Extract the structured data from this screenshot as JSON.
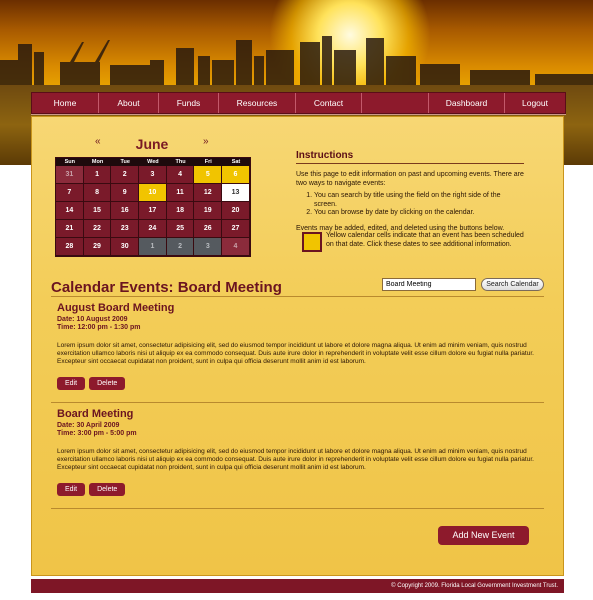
{
  "nav": {
    "items": [
      {
        "label": "Home"
      },
      {
        "label": "About"
      },
      {
        "label": "Funds"
      },
      {
        "label": "Resources"
      },
      {
        "label": "Contact"
      },
      {
        "label": ""
      },
      {
        "label": "Dashboard"
      },
      {
        "label": "Logout"
      }
    ]
  },
  "calendar": {
    "prev": "«",
    "next": "»",
    "month": "June",
    "weekdays": [
      "Sun",
      "Mon",
      "Tue",
      "Wed",
      "Thu",
      "Fri",
      "Sat"
    ],
    "weeks": [
      [
        {
          "d": "31",
          "s": "other"
        },
        {
          "d": "1"
        },
        {
          "d": "2"
        },
        {
          "d": "3"
        },
        {
          "d": "4"
        },
        {
          "d": "5",
          "s": "ev"
        },
        {
          "d": "6",
          "s": "ev"
        }
      ],
      [
        {
          "d": "7"
        },
        {
          "d": "8"
        },
        {
          "d": "9"
        },
        {
          "d": "10",
          "s": "ev"
        },
        {
          "d": "11"
        },
        {
          "d": "12"
        },
        {
          "d": "13",
          "s": "today"
        }
      ],
      [
        {
          "d": "14"
        },
        {
          "d": "15"
        },
        {
          "d": "16"
        },
        {
          "d": "17"
        },
        {
          "d": "18"
        },
        {
          "d": "19"
        },
        {
          "d": "20"
        }
      ],
      [
        {
          "d": "21"
        },
        {
          "d": "22"
        },
        {
          "d": "23"
        },
        {
          "d": "24"
        },
        {
          "d": "25"
        },
        {
          "d": "26"
        },
        {
          "d": "27"
        }
      ],
      [
        {
          "d": "28"
        },
        {
          "d": "29"
        },
        {
          "d": "30"
        },
        {
          "d": "1",
          "s": "other2"
        },
        {
          "d": "2",
          "s": "other2"
        },
        {
          "d": "3",
          "s": "other2"
        },
        {
          "d": "4",
          "s": "other"
        }
      ]
    ]
  },
  "instructions": {
    "title": "Instructions",
    "intro": "Use this page to edit information on past and upcoming events. There are two ways to navigate events:",
    "steps": [
      "You can search by title using the field on the right side of the screen.",
      "You can browse by date by clicking on the calendar."
    ],
    "note": "Events may be added, edited, and deleted using the buttons below.",
    "legend": "Yellow calendar cells indicate that an event has been scheduled on that date. Click these dates to see additional information."
  },
  "page": {
    "title": "Calendar Events: Board Meeting"
  },
  "search": {
    "value": "Board Meeting",
    "button": "Search Calendar"
  },
  "events": [
    {
      "title": "August Board Meeting",
      "date": "Date: 10 August 2009",
      "time": "Time: 12:00 pm - 1:30 pm",
      "body": "Lorem ipsum dolor sit amet, consectetur adipisicing elit, sed do eiusmod tempor incididunt ut labore et dolore magna aliqua. Ut enim ad minim veniam, quis nostrud exercitation ullamco laboris nisi ut aliquip ex ea commodo consequat. Duis aute irure dolor in reprehenderit in voluptate velit esse cillum dolore eu fugiat nulla pariatur. Excepteur sint occaecat cupidatat non proident, sunt in culpa qui officia deserunt mollit anim id est laborum.",
      "edit": "Edit",
      "delete": "Delete"
    },
    {
      "title": "Board Meeting",
      "date": "Date: 30 April 2009",
      "time": "Time: 3:00 pm - 5:00 pm",
      "body": "Lorem ipsum dolor sit amet, consectetur adipisicing elit, sed do eiusmod tempor incididunt ut labore et dolore magna aliqua. Ut enim ad minim veniam, quis nostrud exercitation ullamco laboris nisi ut aliquip ex ea commodo consequat. Duis aute irure dolor in reprehenderit in voluptate velit esse cillum dolore eu fugiat nulla pariatur. Excepteur sint occaecat cupidatat non proident, sunt in culpa qui officia deserunt mollit anim id est laborum.",
      "edit": "Edit",
      "delete": "Delete"
    }
  ],
  "add_button": "Add New Event",
  "footer": "© Copyright 2009. Florida Local Government Investment Trust."
}
